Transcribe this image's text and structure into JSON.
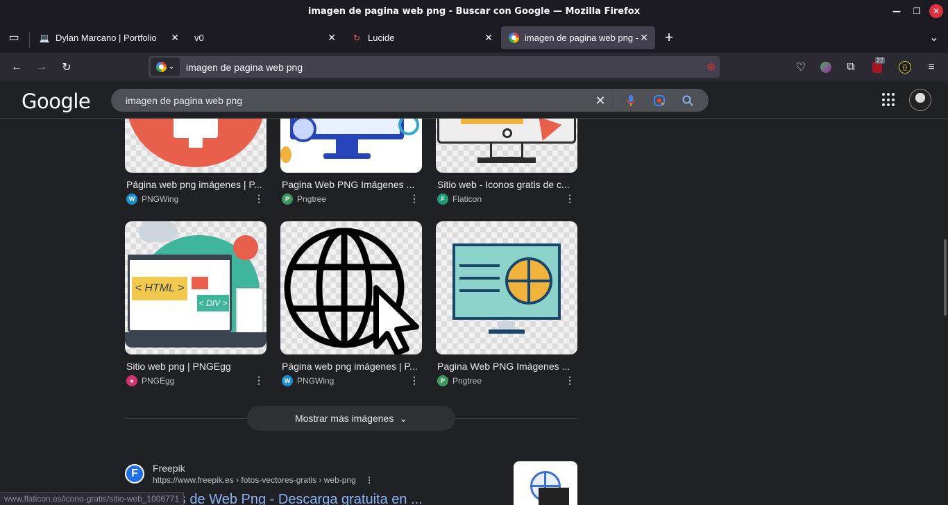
{
  "window": {
    "title": "imagen de pagina web png - Buscar con Google — Mozilla Firefox"
  },
  "tabs": [
    {
      "label": "Dylan Marcano | Portfolio",
      "icon": "laptop-icon"
    },
    {
      "label": "v0",
      "icon": ""
    },
    {
      "label": "Lucide",
      "icon": "lucide-icon"
    },
    {
      "label": "imagen de pagina web png -",
      "icon": "google-icon"
    }
  ],
  "urlbar": {
    "value": "imagen de pagina web png"
  },
  "toolbar": {
    "extensions_badge": "22"
  },
  "google": {
    "logo": "Google",
    "query": "imagen de pagina web png"
  },
  "images": [
    {
      "title": "Página web png imágenes | P...",
      "source": "PNGWing",
      "src_color": "#1a8fd1"
    },
    {
      "title": "Pagina Web PNG Imágenes ...",
      "source": "Pngtree",
      "src_color": "#3c9a5f"
    },
    {
      "title": "Sitio web - Iconos gratis de c...",
      "source": "Flaticon",
      "src_color": "#1e9c7b"
    },
    {
      "title": "Sitio web png | PNGEgg",
      "source": "PNGEgg",
      "src_color": "#d6336c"
    },
    {
      "title": "Página web png imágenes | P...",
      "source": "PNGWing",
      "src_color": "#1a8fd1"
    },
    {
      "title": "Pagina Web PNG Imágenes ...",
      "source": "Pngtree",
      "src_color": "#3c9a5f"
    }
  ],
  "more_button": "Mostrar más imágenes",
  "result": {
    "site": "Freepik",
    "url": "https://www.freepik.es › fotos-vectores-gratis › web-png",
    "title": "Imágenes de Web Png - Descarga gratuita en ..."
  },
  "statusbar": "www.flaticon.es/icono-gratis/sitio-web_1006771"
}
